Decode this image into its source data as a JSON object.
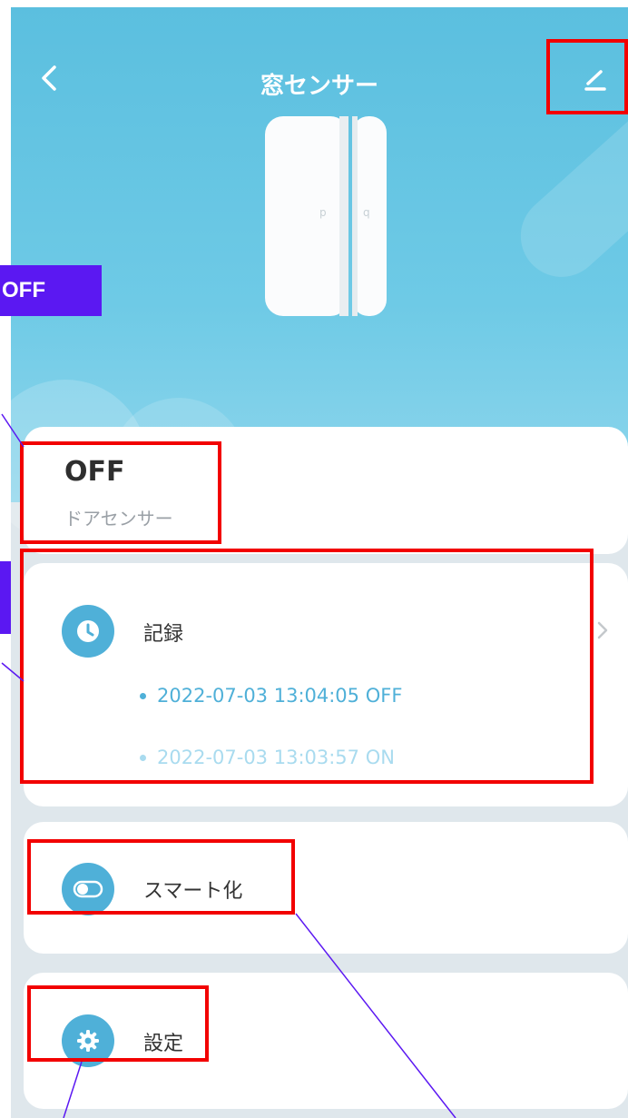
{
  "header": {
    "title": "窓センサー"
  },
  "status": {
    "value": "OFF",
    "label": "ドアセンサー"
  },
  "history": {
    "label": "記録",
    "entries": [
      {
        "text": "2022-07-03 13:04:05 OFF",
        "color": "#4fb0d8"
      },
      {
        "text": "2022-07-03 13:03:57 ON",
        "color": "#a9dbef"
      }
    ]
  },
  "smart": {
    "label": "スマート化"
  },
  "settings": {
    "label": "設定"
  },
  "annotations": {
    "callout_label": "OFF"
  },
  "colors": {
    "accent": "#4fb0d8",
    "hero": "#5bbfdf",
    "highlight_box": "#f20000",
    "callout": "#5b18f2"
  }
}
